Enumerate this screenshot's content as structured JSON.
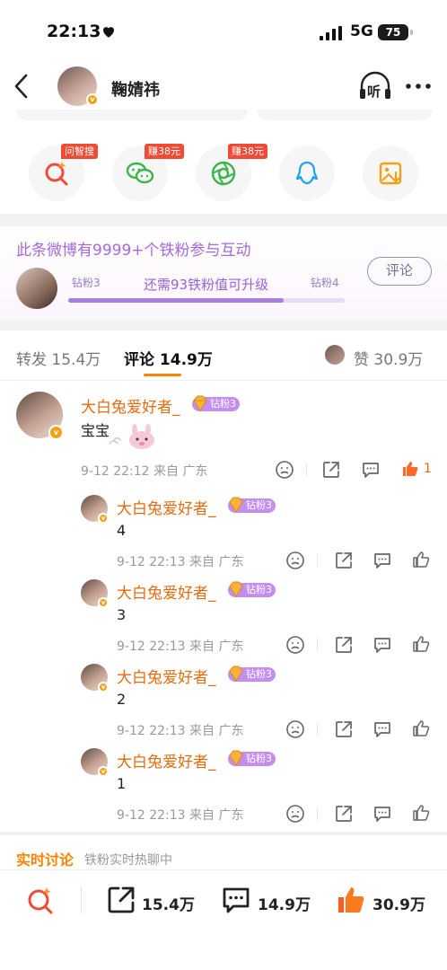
{
  "status_bar": {
    "time": "22:13",
    "network": "5G",
    "battery": "75"
  },
  "header": {
    "author_name": "鞠婧祎",
    "listen_label": "听"
  },
  "share_row": [
    {
      "icon": "ai-search-icon",
      "badge": "问智搜"
    },
    {
      "icon": "wechat-icon",
      "badge": "赚38元"
    },
    {
      "icon": "moments-icon",
      "badge": "赚38元"
    },
    {
      "icon": "qq-icon",
      "badge": ""
    },
    {
      "icon": "save-image-icon",
      "badge": ""
    }
  ],
  "fans_panel": {
    "title": "此条微博有9999+个铁粉参与互动",
    "level_current": "钻粉3",
    "level_next": "钻粉4",
    "progress_text": "还需93铁粉值可升级",
    "progress": 0.78,
    "comment_button": "评论"
  },
  "tabs": {
    "repost": "转发 15.4万",
    "comments": "评论 14.9万",
    "likes": "赞 30.9万"
  },
  "comments": {
    "main": {
      "name": "大白兔爱好者_",
      "fan_level": "钻粉3",
      "text": "宝宝",
      "meta": "9-12 22:12 来自 广东",
      "likes": "1"
    },
    "replies": [
      {
        "name": "大白兔爱好者_",
        "fan_level": "钻粉3",
        "text": "4",
        "meta": "9-12 22:13 来自 广东"
      },
      {
        "name": "大白兔爱好者_",
        "fan_level": "钻粉3",
        "text": "3",
        "meta": "9-12 22:13 来自 广东"
      },
      {
        "name": "大白兔爱好者_",
        "fan_level": "钻粉3",
        "text": "2",
        "meta": "9-12 22:13 来自 广东"
      },
      {
        "name": "大白兔爱好者_",
        "fan_level": "钻粉3",
        "text": "1",
        "meta": "9-12 22:13 来自 广东"
      }
    ]
  },
  "live_discussion": {
    "title": "实时讨论",
    "subtitle": "铁粉实时热聊中"
  },
  "bottom_bar": {
    "reposts": "15.4万",
    "comments": "14.9万",
    "likes": "30.9万"
  },
  "colors": {
    "accent": "#ff8200",
    "name": "#e86b0e",
    "fan_purple": "#a56ad8",
    "like_red": "#ef4b36"
  }
}
